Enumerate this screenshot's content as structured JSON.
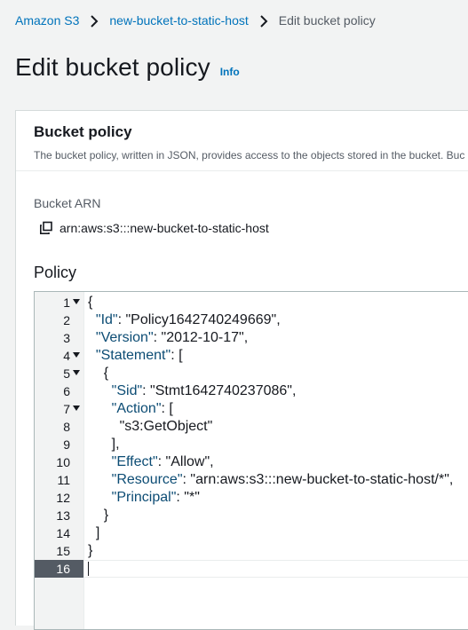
{
  "breadcrumb": {
    "items": [
      "Amazon S3",
      "new-bucket-to-static-host"
    ],
    "current": "Edit bucket policy"
  },
  "header": {
    "title": "Edit bucket policy",
    "info": "Info"
  },
  "panel": {
    "title": "Bucket policy",
    "description": "The bucket policy, written in JSON, provides access to the objects stored in the bucket. Buc"
  },
  "arn": {
    "label": "Bucket ARN",
    "value": "arn:aws:s3:::new-bucket-to-static-host",
    "copy_icon": "copy-icon"
  },
  "policy": {
    "label": "Policy",
    "active_line": 16,
    "fold_lines": [
      1,
      4,
      5,
      7
    ],
    "lines": [
      "{",
      "  \"Id\": \"Policy1642740249669\",",
      "  \"Version\": \"2012-10-17\",",
      "  \"Statement\": [",
      "    {",
      "      \"Sid\": \"Stmt1642740237086\",",
      "      \"Action\": [",
      "        \"s3:GetObject\"",
      "      ],",
      "      \"Effect\": \"Allow\",",
      "      \"Resource\": \"arn:aws:s3:::new-bucket-to-static-host/*\",",
      "      \"Principal\": \"*\"",
      "    }",
      "  ]",
      "}",
      ""
    ]
  }
}
